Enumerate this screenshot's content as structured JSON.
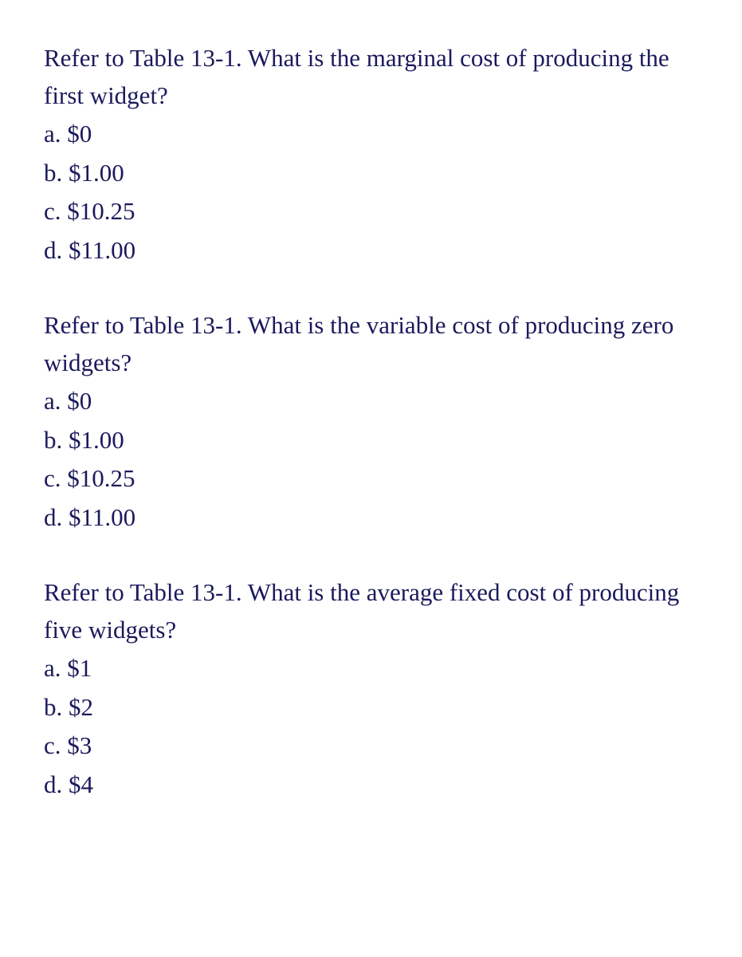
{
  "questions": [
    {
      "prompt": "Refer to Table 13-1. What is the marginal cost of producing the first widget?",
      "options": {
        "a": "a. $0",
        "b": "b. $1.00",
        "c": "c. $10.25",
        "d": "d. $11.00"
      }
    },
    {
      "prompt": "Refer to Table 13-1. What is the variable cost of producing zero widgets?",
      "options": {
        "a": "a. $0",
        "b": "b. $1.00",
        "c": "c. $10.25",
        "d": "d. $11.00"
      }
    },
    {
      "prompt": "Refer to Table 13-1. What is the average fixed cost of producing five widgets?",
      "options": {
        "a": "a. $1",
        "b": "b. $2",
        "c": "c. $3",
        "d": "d. $4"
      }
    }
  ]
}
